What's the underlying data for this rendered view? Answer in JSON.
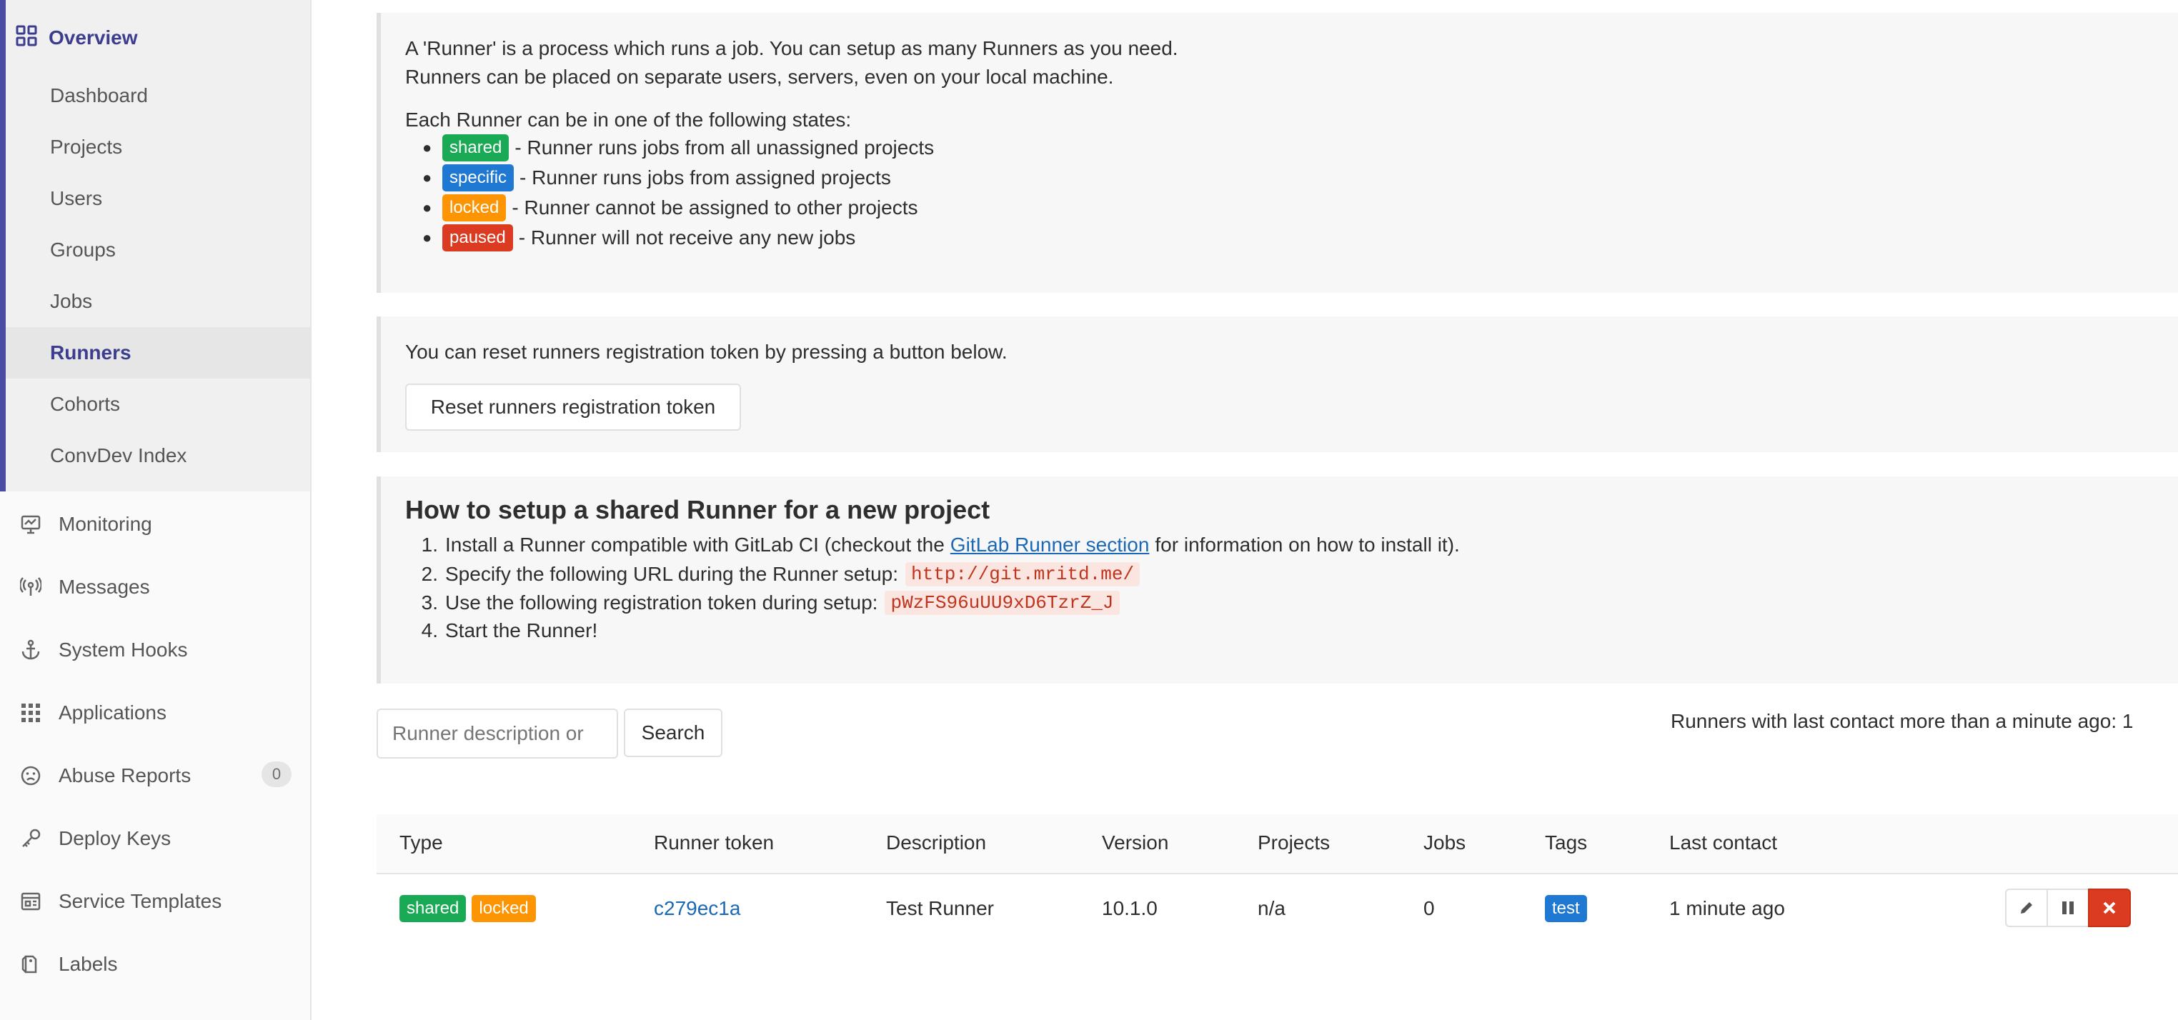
{
  "sidebar": {
    "overview": {
      "label": "Overview",
      "items": [
        {
          "label": "Dashboard"
        },
        {
          "label": "Projects"
        },
        {
          "label": "Users"
        },
        {
          "label": "Groups"
        },
        {
          "label": "Jobs"
        },
        {
          "label": "Runners",
          "active": true
        },
        {
          "label": "Cohorts"
        },
        {
          "label": "ConvDev Index"
        }
      ]
    },
    "nav": [
      {
        "label": "Monitoring",
        "icon": "monitor-icon"
      },
      {
        "label": "Messages",
        "icon": "broadcast-icon"
      },
      {
        "label": "System Hooks",
        "icon": "anchor-icon"
      },
      {
        "label": "Applications",
        "icon": "grid-icon"
      },
      {
        "label": "Abuse Reports",
        "icon": "frown-icon",
        "count": "0"
      },
      {
        "label": "Deploy Keys",
        "icon": "key-icon"
      },
      {
        "label": "Service Templates",
        "icon": "template-icon"
      },
      {
        "label": "Labels",
        "icon": "label-icon"
      }
    ]
  },
  "info": {
    "line1": "A 'Runner' is a process which runs a job. You can setup as many Runners as you need.",
    "line2": "Runners can be placed on separate users, servers, even on your local machine.",
    "states_intro": "Each Runner can be in one of the following states:",
    "states": [
      {
        "badge": "shared",
        "text": "- Runner runs jobs from all unassigned projects"
      },
      {
        "badge": "specific",
        "text": "- Runner runs jobs from assigned projects"
      },
      {
        "badge": "locked",
        "text": "- Runner cannot be assigned to other projects"
      },
      {
        "badge": "paused",
        "text": "- Runner will not receive any new jobs"
      }
    ]
  },
  "reset": {
    "text": "You can reset runners registration token by pressing a button below.",
    "button": "Reset runners registration token"
  },
  "setup": {
    "title": "How to setup a shared Runner for a new project",
    "step1_pre": "Install a Runner compatible with GitLab CI (checkout the",
    "step1_link": "GitLab Runner section",
    "step1_post": "for information on how to install it).",
    "step2": "Specify the following URL during the Runner setup:",
    "step2_code": "http://git.mritd.me/",
    "step3": "Use the following registration token during setup:",
    "step3_code": "pWzFS96uUU9xD6TzrZ_J",
    "step4": "Start the Runner!"
  },
  "search": {
    "placeholder": "Runner description or",
    "button": "Search",
    "last_contact": "Runners with last contact more than a minute ago: 1"
  },
  "table": {
    "headers": [
      "Type",
      "Runner token",
      "Description",
      "Version",
      "Projects",
      "Jobs",
      "Tags",
      "Last contact"
    ],
    "rows": [
      {
        "types": [
          "shared",
          "locked"
        ],
        "token": "c279ec1a",
        "description": "Test Runner",
        "version": "10.1.0",
        "projects": "n/a",
        "jobs": "0",
        "tags": [
          "test"
        ],
        "last_contact": "1 minute ago"
      }
    ]
  },
  "colors": {
    "accent": "#4b4ba3",
    "shared": "#1aaa55",
    "specific": "#1f78d1",
    "locked": "#fc9403",
    "paused": "#db3b21",
    "link": "#1b69b6"
  }
}
